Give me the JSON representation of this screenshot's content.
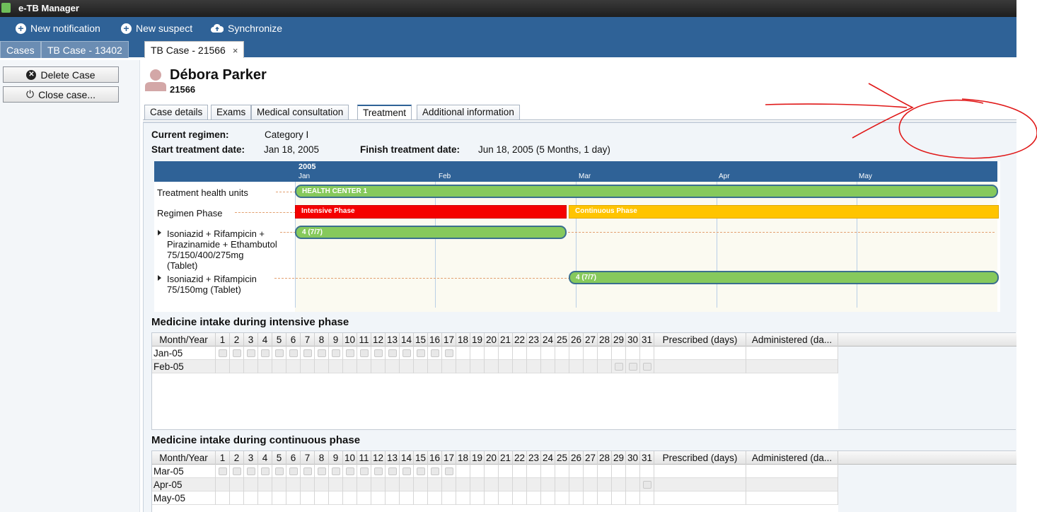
{
  "app": {
    "title": "e-TB Manager"
  },
  "toolbar": {
    "new_notification": "New notification",
    "new_suspect": "New suspect",
    "synchronize": "Synchronize"
  },
  "window_tabs": [
    {
      "label": "Cases"
    },
    {
      "label": "TB Case - 13402"
    },
    {
      "label": "TB Case - 21566",
      "close": "×"
    }
  ],
  "left_panel": {
    "delete_case": "Delete Case",
    "close_case": "Close case..."
  },
  "patient": {
    "name": "Débora Parker",
    "number": "21566"
  },
  "case_tabs": [
    "Case details",
    "Exams",
    "Medical consultation",
    "Treatment",
    "Additional information"
  ],
  "regimen": {
    "current_label": "Current regimen:",
    "current_value": "Category I",
    "start_label": "Start treatment date:",
    "start_value": "Jan 18, 2005",
    "finish_label": "Finish treatment date:",
    "finish_value": "Jun 18, 2005 (5 Months, 1 day)"
  },
  "gantt": {
    "year": "2005",
    "months": [
      "Jan",
      "Feb",
      "Mar",
      "Apr",
      "May"
    ],
    "rows": [
      {
        "label": "Treatment health units"
      },
      {
        "label": "Regimen Phase"
      },
      {
        "label_lines": [
          "Isoniazid + Rifampicin +",
          "Pirazinamide + Ethambutol",
          "75/150/400/275mg",
          "(Tablet)"
        ]
      },
      {
        "label_lines": [
          "Isoniazid + Rifampicin",
          "75/150mg (Tablet)"
        ]
      }
    ],
    "bars": {
      "health_unit": "HEALTH CENTER 1",
      "intensive": "Intensive Phase",
      "continuous": "Continuous Phase",
      "med1": "4 (7/7)",
      "med2": "4 (7/7)"
    }
  },
  "intake_intensive": {
    "title": "Medicine intake during intensive phase",
    "headers": [
      "Month/Year",
      "1",
      "2",
      "3",
      "4",
      "5",
      "6",
      "7",
      "8",
      "9",
      "10",
      "11",
      "12",
      "13",
      "14",
      "15",
      "16",
      "17",
      "18",
      "19",
      "20",
      "21",
      "22",
      "23",
      "24",
      "25",
      "26",
      "27",
      "28",
      "29",
      "30",
      "31",
      "Prescribed (days)",
      "Administered (da..."
    ],
    "rows": [
      {
        "month": "Jan-05",
        "days_with_box": [
          1,
          2,
          3,
          4,
          5,
          6,
          7,
          8,
          9,
          10,
          11,
          12,
          13,
          14,
          15,
          16,
          17
        ]
      },
      {
        "month": "Feb-05",
        "days_with_box": [
          29,
          30,
          31
        ]
      }
    ]
  },
  "intake_continuous": {
    "title": "Medicine intake during continuous phase",
    "headers": [
      "Month/Year",
      "1",
      "2",
      "3",
      "4",
      "5",
      "6",
      "7",
      "8",
      "9",
      "10",
      "11",
      "12",
      "13",
      "14",
      "15",
      "16",
      "17",
      "18",
      "19",
      "20",
      "21",
      "22",
      "23",
      "24",
      "25",
      "26",
      "27",
      "28",
      "29",
      "30",
      "31",
      "Prescribed (days)",
      "Administered (da..."
    ],
    "rows": [
      {
        "month": "Mar-05",
        "days_with_box": [
          1,
          2,
          3,
          4,
          5,
          6,
          7,
          8,
          9,
          10,
          11,
          12,
          13,
          14,
          15,
          16,
          17
        ]
      },
      {
        "month": "Apr-05",
        "days_with_box": [
          31
        ]
      },
      {
        "month": "May-05",
        "days_with_box": []
      }
    ]
  },
  "colors": {
    "header_blue": "#2f6297",
    "bar_green": "#86c95c",
    "intensive_red": "#f50000",
    "continuous_yellow": "#ffc400",
    "annotation_red": "#e01818"
  }
}
